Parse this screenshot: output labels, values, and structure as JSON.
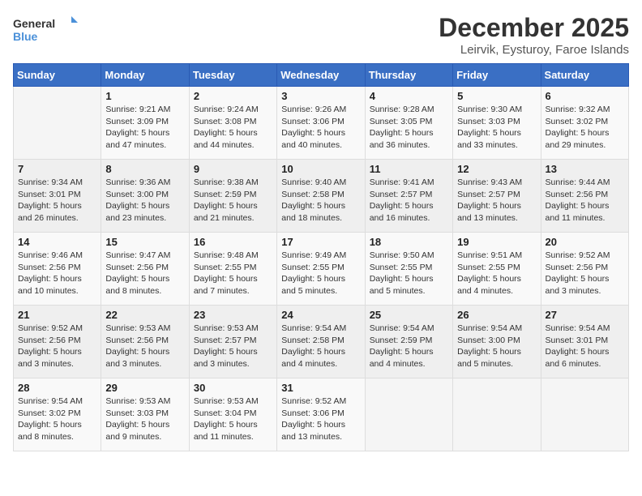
{
  "header": {
    "logo_line1": "General",
    "logo_line2": "Blue",
    "month_title": "December 2025",
    "location": "Leirvik, Eysturoy, Faroe Islands"
  },
  "days_of_week": [
    "Sunday",
    "Monday",
    "Tuesday",
    "Wednesday",
    "Thursday",
    "Friday",
    "Saturday"
  ],
  "weeks": [
    [
      {
        "day": "",
        "info": ""
      },
      {
        "day": "1",
        "info": "Sunrise: 9:21 AM\nSunset: 3:09 PM\nDaylight: 5 hours\nand 47 minutes."
      },
      {
        "day": "2",
        "info": "Sunrise: 9:24 AM\nSunset: 3:08 PM\nDaylight: 5 hours\nand 44 minutes."
      },
      {
        "day": "3",
        "info": "Sunrise: 9:26 AM\nSunset: 3:06 PM\nDaylight: 5 hours\nand 40 minutes."
      },
      {
        "day": "4",
        "info": "Sunrise: 9:28 AM\nSunset: 3:05 PM\nDaylight: 5 hours\nand 36 minutes."
      },
      {
        "day": "5",
        "info": "Sunrise: 9:30 AM\nSunset: 3:03 PM\nDaylight: 5 hours\nand 33 minutes."
      },
      {
        "day": "6",
        "info": "Sunrise: 9:32 AM\nSunset: 3:02 PM\nDaylight: 5 hours\nand 29 minutes."
      }
    ],
    [
      {
        "day": "7",
        "info": "Sunrise: 9:34 AM\nSunset: 3:01 PM\nDaylight: 5 hours\nand 26 minutes."
      },
      {
        "day": "8",
        "info": "Sunrise: 9:36 AM\nSunset: 3:00 PM\nDaylight: 5 hours\nand 23 minutes."
      },
      {
        "day": "9",
        "info": "Sunrise: 9:38 AM\nSunset: 2:59 PM\nDaylight: 5 hours\nand 21 minutes."
      },
      {
        "day": "10",
        "info": "Sunrise: 9:40 AM\nSunset: 2:58 PM\nDaylight: 5 hours\nand 18 minutes."
      },
      {
        "day": "11",
        "info": "Sunrise: 9:41 AM\nSunset: 2:57 PM\nDaylight: 5 hours\nand 16 minutes."
      },
      {
        "day": "12",
        "info": "Sunrise: 9:43 AM\nSunset: 2:57 PM\nDaylight: 5 hours\nand 13 minutes."
      },
      {
        "day": "13",
        "info": "Sunrise: 9:44 AM\nSunset: 2:56 PM\nDaylight: 5 hours\nand 11 minutes."
      }
    ],
    [
      {
        "day": "14",
        "info": "Sunrise: 9:46 AM\nSunset: 2:56 PM\nDaylight: 5 hours\nand 10 minutes."
      },
      {
        "day": "15",
        "info": "Sunrise: 9:47 AM\nSunset: 2:56 PM\nDaylight: 5 hours\nand 8 minutes."
      },
      {
        "day": "16",
        "info": "Sunrise: 9:48 AM\nSunset: 2:55 PM\nDaylight: 5 hours\nand 7 minutes."
      },
      {
        "day": "17",
        "info": "Sunrise: 9:49 AM\nSunset: 2:55 PM\nDaylight: 5 hours\nand 5 minutes."
      },
      {
        "day": "18",
        "info": "Sunrise: 9:50 AM\nSunset: 2:55 PM\nDaylight: 5 hours\nand 5 minutes."
      },
      {
        "day": "19",
        "info": "Sunrise: 9:51 AM\nSunset: 2:55 PM\nDaylight: 5 hours\nand 4 minutes."
      },
      {
        "day": "20",
        "info": "Sunrise: 9:52 AM\nSunset: 2:56 PM\nDaylight: 5 hours\nand 3 minutes."
      }
    ],
    [
      {
        "day": "21",
        "info": "Sunrise: 9:52 AM\nSunset: 2:56 PM\nDaylight: 5 hours\nand 3 minutes."
      },
      {
        "day": "22",
        "info": "Sunrise: 9:53 AM\nSunset: 2:56 PM\nDaylight: 5 hours\nand 3 minutes."
      },
      {
        "day": "23",
        "info": "Sunrise: 9:53 AM\nSunset: 2:57 PM\nDaylight: 5 hours\nand 3 minutes."
      },
      {
        "day": "24",
        "info": "Sunrise: 9:54 AM\nSunset: 2:58 PM\nDaylight: 5 hours\nand 4 minutes."
      },
      {
        "day": "25",
        "info": "Sunrise: 9:54 AM\nSunset: 2:59 PM\nDaylight: 5 hours\nand 4 minutes."
      },
      {
        "day": "26",
        "info": "Sunrise: 9:54 AM\nSunset: 3:00 PM\nDaylight: 5 hours\nand 5 minutes."
      },
      {
        "day": "27",
        "info": "Sunrise: 9:54 AM\nSunset: 3:01 PM\nDaylight: 5 hours\nand 6 minutes."
      }
    ],
    [
      {
        "day": "28",
        "info": "Sunrise: 9:54 AM\nSunset: 3:02 PM\nDaylight: 5 hours\nand 8 minutes."
      },
      {
        "day": "29",
        "info": "Sunrise: 9:53 AM\nSunset: 3:03 PM\nDaylight: 5 hours\nand 9 minutes."
      },
      {
        "day": "30",
        "info": "Sunrise: 9:53 AM\nSunset: 3:04 PM\nDaylight: 5 hours\nand 11 minutes."
      },
      {
        "day": "31",
        "info": "Sunrise: 9:52 AM\nSunset: 3:06 PM\nDaylight: 5 hours\nand 13 minutes."
      },
      {
        "day": "",
        "info": ""
      },
      {
        "day": "",
        "info": ""
      },
      {
        "day": "",
        "info": ""
      }
    ]
  ]
}
